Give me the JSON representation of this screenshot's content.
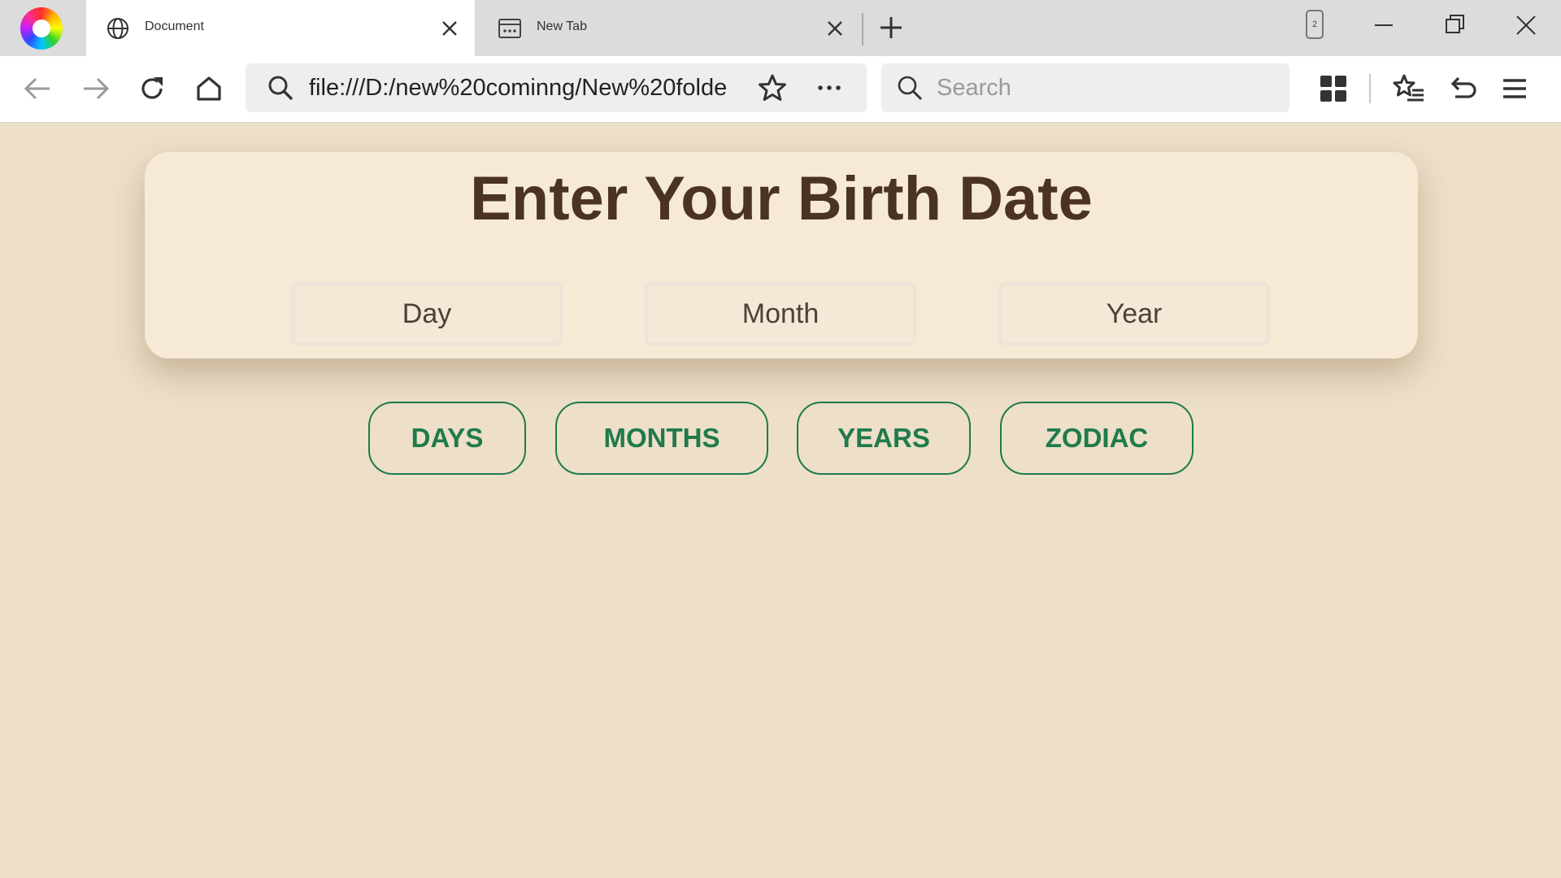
{
  "browser": {
    "tabs": [
      {
        "title": "Document",
        "active": true,
        "icon": "globe-icon"
      },
      {
        "title": "New Tab",
        "active": false,
        "icon": "new-tab-page-icon"
      }
    ],
    "tab_count": "2",
    "address_bar": {
      "url": "file:///D:/new%20cominng/New%20folde"
    },
    "search": {
      "placeholder": "Search"
    }
  },
  "page": {
    "title": "Enter Your Birth Date",
    "inputs": {
      "day_placeholder": "Day",
      "month_placeholder": "Month",
      "year_placeholder": "Year"
    },
    "buttons": {
      "days": "DAYS",
      "months": "MONTHS",
      "years": "YEARS",
      "zodiac": "ZODIAC"
    }
  },
  "colors": {
    "page_background": "#eddfc8",
    "card_background": "#f6ead7",
    "title_text": "#4a3224",
    "accent_green": "#1f7a4c"
  }
}
